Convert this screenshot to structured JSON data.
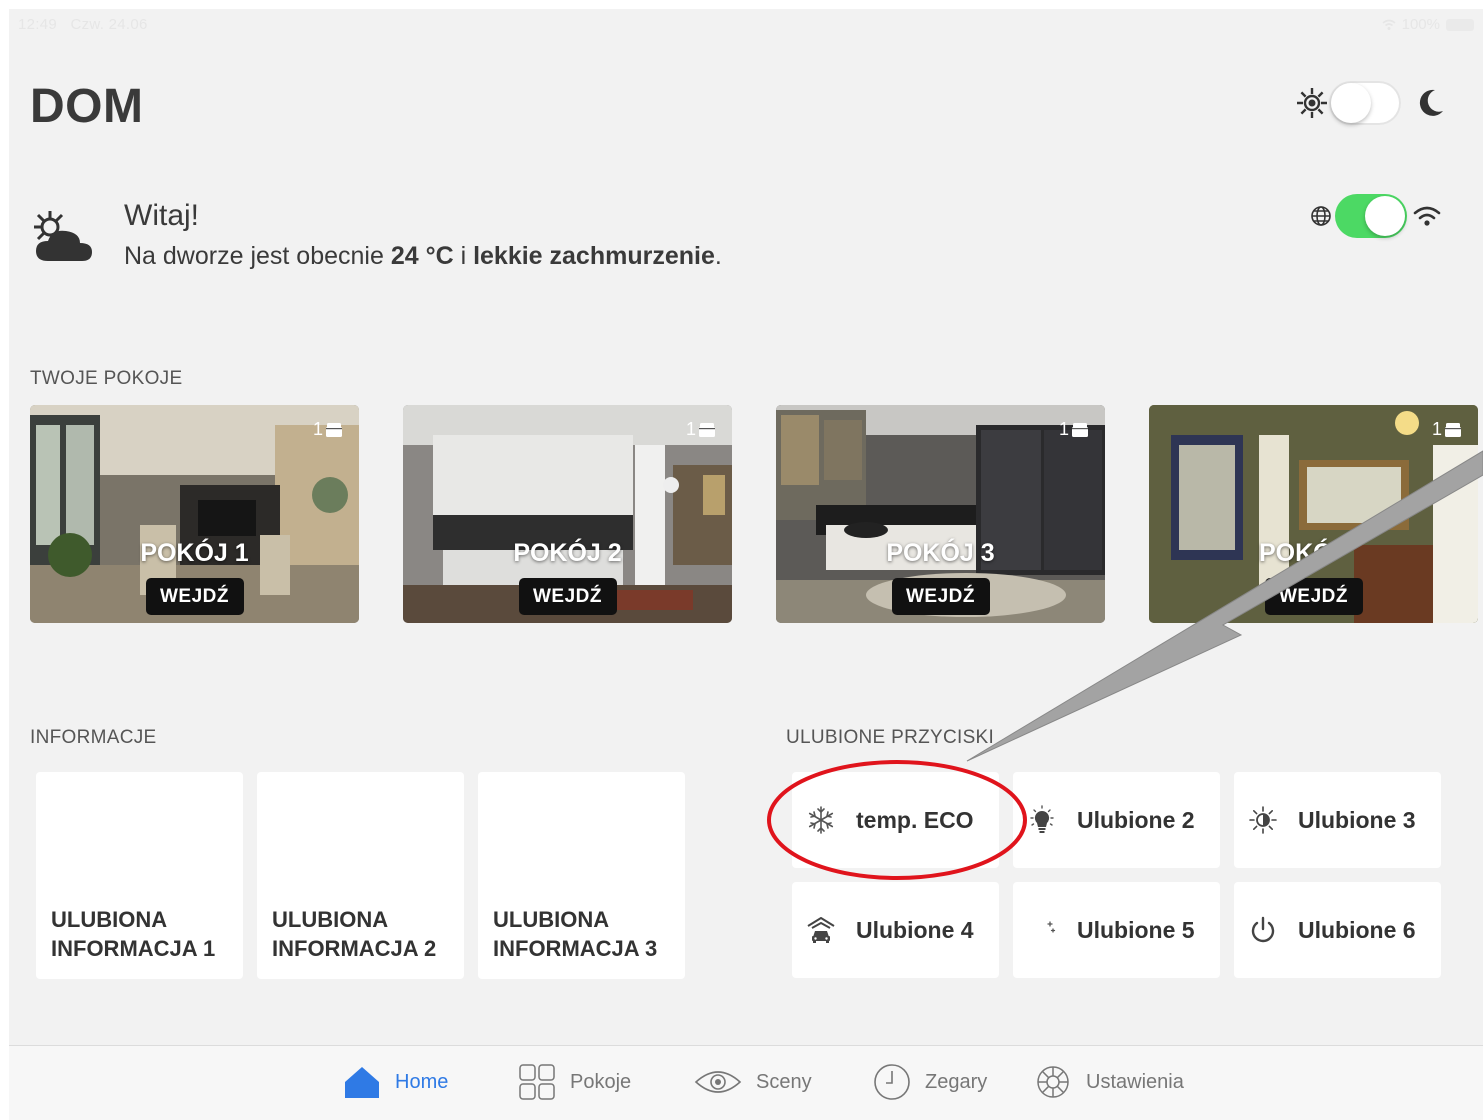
{
  "status_bar": {
    "time": "12:49",
    "date": "Czw. 24.06",
    "battery": "100%"
  },
  "header": {
    "title": "DOM"
  },
  "theme_toggle": {
    "left_icon": "sun-icon",
    "right_icon": "moon-icon",
    "dark_mode": false
  },
  "network_toggle": {
    "left_icon": "globe-icon",
    "right_icon": "wifi-icon",
    "on": true,
    "color": "#4cd964"
  },
  "welcome": {
    "greeting": "Witaj!",
    "prefix": "Na dworze jest obecnie ",
    "temperature": "24 °C",
    "connector": " i ",
    "condition": "lekkie zachmurzenie",
    "suffix": "."
  },
  "rooms": {
    "label": "TWOJE POKOJE",
    "enter_label": "WEJDŹ",
    "items": [
      {
        "name": "POKÓJ 1",
        "count": "1"
      },
      {
        "name": "POKÓJ 2",
        "count": "1"
      },
      {
        "name": "POKÓJ 3",
        "count": "1"
      },
      {
        "name": "POKÓ",
        "count": "1"
      }
    ]
  },
  "info": {
    "label": "INFORMACJE",
    "tiles": [
      "ULUBIONA INFORMACJA 1",
      "ULUBIONA INFORMACJA 2",
      "ULUBIONA INFORMACJA 3"
    ]
  },
  "favorites": {
    "label": "ULUBIONE PRZYCISKI",
    "buttons": [
      {
        "label": "temp. ECO",
        "icon": "snowflake-icon"
      },
      {
        "label": "Ulubione 2",
        "icon": "lightbulb-icon"
      },
      {
        "label": "Ulubione 3",
        "icon": "brightness-icon"
      },
      {
        "label": "Ulubione 4",
        "icon": "garage-icon"
      },
      {
        "label": "Ulubione 5",
        "icon": "night-moon-icon"
      },
      {
        "label": "Ulubione 6",
        "icon": "power-icon"
      }
    ]
  },
  "annotation": {
    "color": "#e0141c"
  },
  "tabbar": {
    "active_color": "#2f7ae5",
    "tabs": [
      {
        "label": "Home",
        "icon": "home-icon",
        "active": true
      },
      {
        "label": "Pokoje",
        "icon": "grid-icon",
        "active": false
      },
      {
        "label": "Sceny",
        "icon": "eye-icon",
        "active": false
      },
      {
        "label": "Zegary",
        "icon": "clock-icon",
        "active": false
      },
      {
        "label": "Ustawienia",
        "icon": "settings-icon",
        "active": false
      }
    ]
  }
}
